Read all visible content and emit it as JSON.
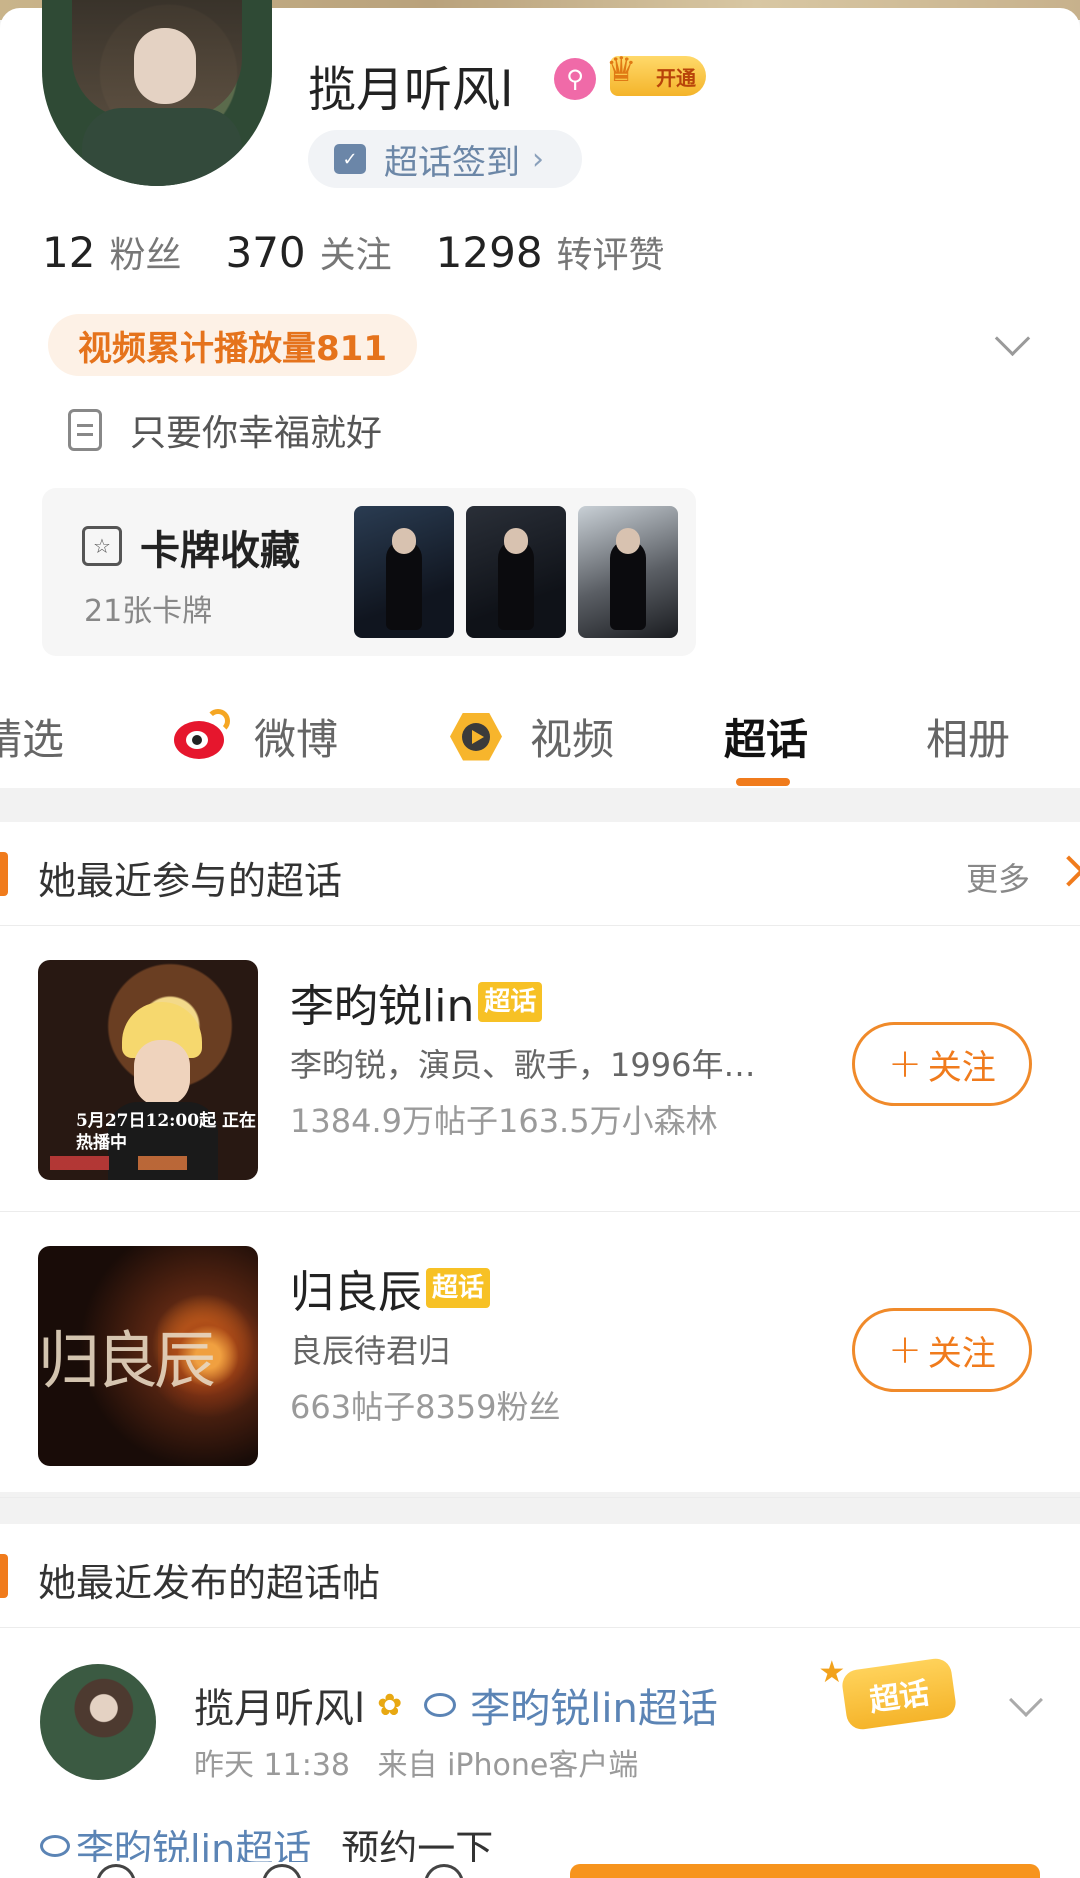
{
  "profile": {
    "username": "揽月听风l",
    "vip_label": "开通",
    "signin_label": "超话签到",
    "stats": [
      {
        "num": "12",
        "label": "粉丝"
      },
      {
        "num": "370",
        "label": "关注"
      },
      {
        "num": "1298",
        "label": "转评赞"
      }
    ],
    "play_count": "视频累计播放量811",
    "bio": "只要你幸福就好",
    "cards": {
      "title": "卡牌收藏",
      "count": "21张卡牌"
    }
  },
  "tabs": [
    {
      "label": "精选",
      "active": false
    },
    {
      "label": "微博",
      "active": false
    },
    {
      "label": "视频",
      "active": false
    },
    {
      "label": "超话",
      "active": true
    },
    {
      "label": "相册",
      "active": false
    }
  ],
  "recent_topics": {
    "title": "她最近参与的超话",
    "more": "更多",
    "items": [
      {
        "name": "李昀锐lin",
        "tag": "超话",
        "desc": "李昀锐，演员、歌手，1996年…",
        "stats": "1384.9万帖子163.5万小森林",
        "follow": "关注",
        "cover_text": "5月27日12:00起 正在热播中"
      },
      {
        "name": "归良辰",
        "tag": "超话",
        "desc": "良辰待君归",
        "stats": "663帖子8359粉丝",
        "follow": "关注",
        "cover_text": "归良辰"
      }
    ]
  },
  "recent_posts": {
    "title": "她最近发布的超话帖",
    "post": {
      "user": "揽月听风l",
      "topic": "李昀锐lin超话",
      "sticker": "超话",
      "time": "昨天 11:38",
      "source": "来自 iPhone客户端",
      "body_tag": "李昀锐lin超话",
      "body_text": "预约一下"
    }
  },
  "colors": {
    "accent": "#f07b1c",
    "link": "#5b84b5",
    "chao_tag": "#f7c125"
  }
}
